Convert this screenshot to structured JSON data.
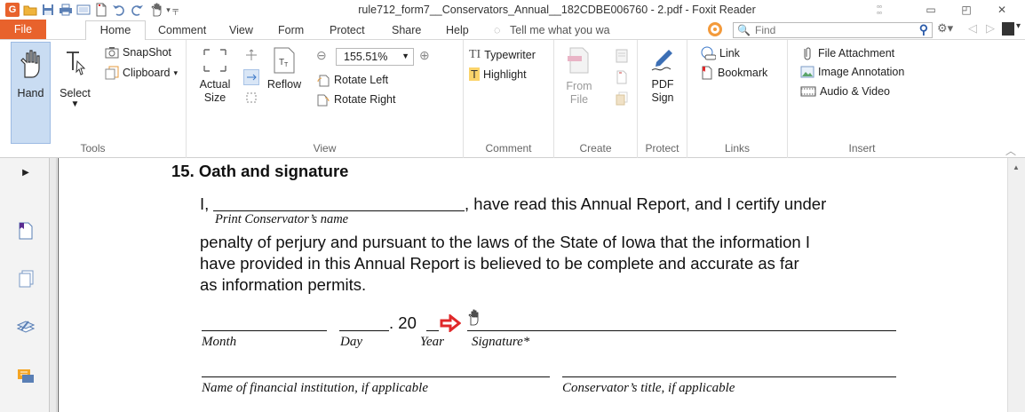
{
  "window": {
    "title": "rule712_form7__Conservators_Annual__182CDBE006760 - 2.pdf - Foxit Reader"
  },
  "tabs": [
    "File",
    "Home",
    "Comment",
    "View",
    "Form",
    "Protect",
    "Share",
    "Help"
  ],
  "tell_me": "Tell me what you wa",
  "find_placeholder": "Find",
  "ribbon": {
    "tools": {
      "label": "Tools",
      "hand": "Hand",
      "select": "Select",
      "snapshot": "SnapShot",
      "clipboard": "Clipboard"
    },
    "view": {
      "label": "View",
      "actual_size_line1": "Actual",
      "actual_size_line2": "Size",
      "reflow": "Reflow",
      "zoom": "155.51%",
      "rotate_left": "Rotate Left",
      "rotate_right": "Rotate Right"
    },
    "comment": {
      "label": "Comment",
      "typewriter": "Typewriter",
      "highlight": "Highlight"
    },
    "create": {
      "label": "Create",
      "from_line1": "From",
      "from_line2": "File"
    },
    "protect": {
      "label": "Protect",
      "pdf_sign_line1": "PDF",
      "pdf_sign_line2": "Sign"
    },
    "links": {
      "label": "Links",
      "link": "Link",
      "bookmark": "Bookmark"
    },
    "insert": {
      "label": "Insert",
      "file_attachment": "File Attachment",
      "image_annotation": "Image Annotation",
      "audio_video": "Audio & Video"
    }
  },
  "document": {
    "heading": "15. Oath and signature",
    "line1_prefix": "I,",
    "line1_suffix": ", have read this Annual Report, and I certify under",
    "print_name_label": "Print Conservator’s name",
    "para_line2": "penalty of perjury and pursuant to the laws of the State of Iowa that the information I",
    "para_line3": "have provided in this Annual Report is believed to be complete and accurate as far",
    "para_line4": "as information permits.",
    "year_prefix": ". 20",
    "labels": {
      "month": "Month",
      "day": "Day",
      "year": "Year",
      "signature": "Signature*",
      "financial_institution": "Name of financial institution, if applicable",
      "conservator_title": "Conservator’s title, if applicable"
    }
  },
  "colors": {
    "accent": "#e8622c",
    "active_tool": "#c9dcf2",
    "arrow": "#e0282a"
  }
}
